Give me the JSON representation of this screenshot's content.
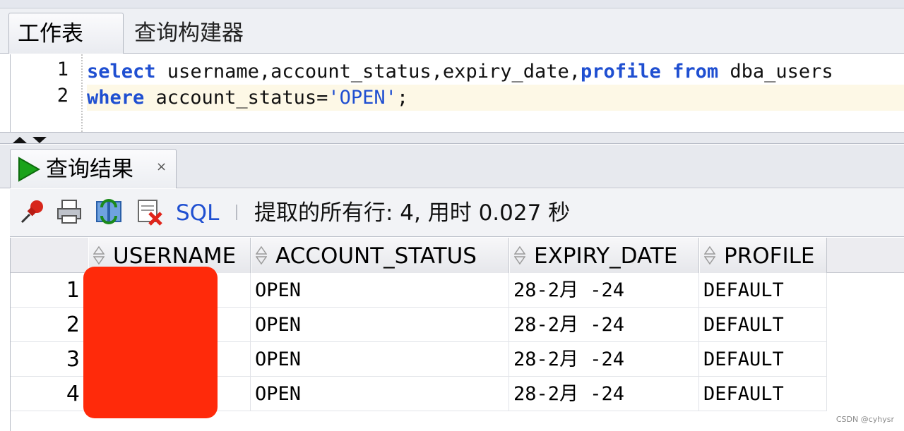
{
  "tabs": [
    {
      "label": "工作表",
      "active": true
    },
    {
      "label": "查询构建器",
      "active": false
    }
  ],
  "editor": {
    "lines": [
      {
        "number": "1",
        "tokens": [
          {
            "t": "select",
            "k": "kw"
          },
          {
            "t": " username,account_status,expiry_date,",
            "k": "plain"
          },
          {
            "t": "profile",
            "k": "kw"
          },
          {
            "t": " ",
            "k": "plain"
          },
          {
            "t": "from",
            "k": "kw"
          },
          {
            "t": " dba_users",
            "k": "plain"
          }
        ]
      },
      {
        "number": "2",
        "tokens": [
          {
            "t": "where",
            "k": "kw"
          },
          {
            "t": " account_status=",
            "k": "plain"
          },
          {
            "t": "'OPEN'",
            "k": "str"
          },
          {
            "t": ";",
            "k": "plain"
          }
        ]
      }
    ]
  },
  "results_tab": {
    "label": "查询结果",
    "close": "×"
  },
  "toolbar": {
    "icons": [
      "pin-icon",
      "print-icon",
      "refresh-icon",
      "delete-icon"
    ],
    "sql_label": "SQL",
    "status": "提取的所有行: 4, 用时 0.027 秒"
  },
  "grid": {
    "columns": [
      "USERNAME",
      "ACCOUNT_STATUS",
      "EXPIRY_DATE",
      "PROFILE"
    ],
    "rows": [
      {
        "n": "1",
        "username": "",
        "account_status": "OPEN",
        "expiry_date": "28-2月 -24",
        "profile": "DEFAULT"
      },
      {
        "n": "2",
        "username": "",
        "account_status": "OPEN",
        "expiry_date": "28-2月 -24",
        "profile": "DEFAULT"
      },
      {
        "n": "3",
        "username": "",
        "account_status": "OPEN",
        "expiry_date": "28-2月 -24",
        "profile": "DEFAULT"
      },
      {
        "n": "4",
        "username": "",
        "account_status": "OPEN",
        "expiry_date": "28-2月 -24",
        "profile": "DEFAULT"
      }
    ]
  },
  "watermark": "CSDN @cyhysr",
  "colors": {
    "keyword": "#1f4fd1",
    "redaction": "#ff2a0a",
    "run": "#1aa31a"
  }
}
